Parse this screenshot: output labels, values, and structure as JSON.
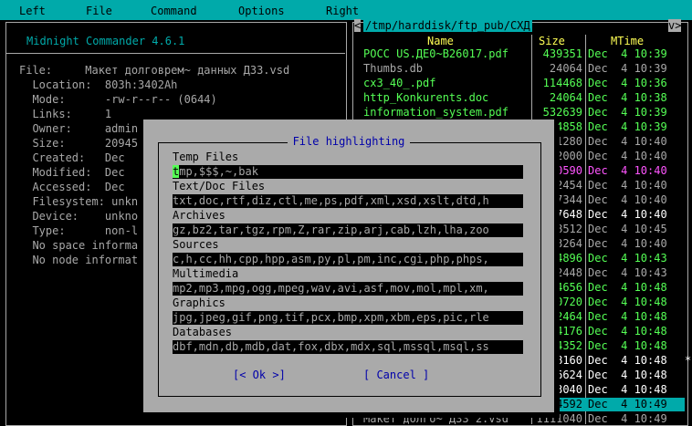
{
  "menu": [
    "Left",
    "File",
    "Command",
    "Options",
    "Right"
  ],
  "left_panel": {
    "title": "Midnight Commander 4.6.1",
    "info_lines": [
      "File:     Макет долговрем~ данных ДЗЗ.vsd",
      "  Location:  803h:3402Ah",
      "  Mode:      -rw-r--r-- (0644)",
      "  Links:     1",
      "  Owner:     admin",
      "  Size:      20945",
      "  Created:   Dec",
      "  Modified:  Dec",
      "  Accessed:  Dec",
      "  Filesystem: unkn",
      "  Device:    unkno",
      "  Type:      non-l",
      "  No space informa",
      "  No node informat"
    ]
  },
  "right_panel": {
    "path": "/tmp/harddisk/ftp_pub/СХД",
    "left_arrow": "<",
    "right_arrow": "v>",
    "col_name": "Name",
    "col_size": "Size",
    "col_mtime": "MTime",
    "files": [
      {
        "name": "РОСС US.ДЕ0~B26017.pdf",
        "size": "439351",
        "date": "Dec  4 10:39",
        "color": "green"
      },
      {
        "name": "Thumbs.db",
        "size": "24064",
        "date": "Dec  4 10:39",
        "color": "gray"
      },
      {
        "name": "cx3_40_.pdf",
        "size": "114468",
        "date": "Dec  4 10:36",
        "color": "green"
      },
      {
        "name": "http_Konkurents.doc",
        "size": "24064",
        "date": "Dec  4 10:38",
        "color": "green"
      },
      {
        "name": "information_system.pdf",
        "size": "532639",
        "date": "Dec  4 10:39",
        "color": "green"
      },
      {
        "name": "",
        "size": "4858",
        "date": "Dec  4 10:39",
        "color": "green"
      },
      {
        "name": "",
        "size": "1280",
        "date": "Dec  4 10:40",
        "color": "gray"
      },
      {
        "name": "",
        "size": "2000",
        "date": "Dec  4 10:40",
        "color": "gray"
      },
      {
        "name": "",
        "size": "0590",
        "date": "Dec  4 10:40",
        "color": "magenta"
      },
      {
        "name": "",
        "size": "2454",
        "date": "Dec  4 10:40",
        "color": "gray"
      },
      {
        "name": "",
        "size": "7344",
        "date": "Dec  4 10:40",
        "color": "gray"
      },
      {
        "name": "",
        "size": "7648",
        "date": "Dec  4 10:40",
        "color": "white"
      },
      {
        "name": "",
        "size": "8512",
        "date": "Dec  4 10:45",
        "color": "gray"
      },
      {
        "name": "",
        "size": "3264",
        "date": "Dec  4 10:40",
        "color": "gray"
      },
      {
        "name": "",
        "size": "4896",
        "date": "Dec  4 10:43",
        "color": "green"
      },
      {
        "name": "",
        "size": "2448",
        "date": "Dec  4 10:43",
        "color": "gray"
      },
      {
        "name": "",
        "size": "4656",
        "date": "Dec  4 10:48",
        "color": "green"
      },
      {
        "name": "",
        "size": "0720",
        "date": "Dec  4 10:48",
        "color": "green"
      },
      {
        "name": "",
        "size": "2464",
        "date": "Dec  4 10:48",
        "color": "green"
      },
      {
        "name": "",
        "size": "4176",
        "date": "Dec  4 10:48",
        "color": "green"
      },
      {
        "name": "",
        "size": "4352",
        "date": "Dec  4 10:48",
        "color": "green"
      },
      {
        "name": "",
        "size": "8160",
        "date": "Dec  4 10:48",
        "color": "white"
      },
      {
        "name": "",
        "size": "6624",
        "date": "Dec  4 10:48",
        "color": "white"
      },
      {
        "name": "",
        "size": "3040",
        "date": "Dec  4 10:48",
        "color": "white"
      },
      {
        "name": "",
        "size": "4592",
        "date": "Dec  4 10:49",
        "color": "selected"
      },
      {
        "name": "Макет долго~ ДЗЗ 2.vsd",
        "size": "1111040",
        "date": "Dec  4 10:49",
        "color": "gray"
      }
    ],
    "scroll_mark": "*"
  },
  "dialog": {
    "title": "File highlighting",
    "groups": [
      {
        "label": "Temp Files",
        "value": "tmp,$$$,~,bak"
      },
      {
        "label": "Text/Doc Files",
        "value": "txt,doc,rtf,diz,ctl,me,ps,pdf,xml,xsd,xslt,dtd,h"
      },
      {
        "label": "Archives",
        "value": "gz,bz2,tar,tgz,rpm,Z,rar,zip,arj,cab,lzh,lha,zoo"
      },
      {
        "label": "Sources",
        "value": "c,h,cc,hh,cpp,hpp,asm,py,pl,pm,inc,cgi,php,phps,"
      },
      {
        "label": "Multimedia",
        "value": "mp2,mp3,mpg,ogg,mpeg,wav,avi,asf,mov,mol,mpl,xm,"
      },
      {
        "label": "Graphics",
        "value": "jpg,jpeg,gif,png,tif,pcx,bmp,xpm,xbm,eps,pic,rle"
      },
      {
        "label": "Databases",
        "value": "dbf,mdn,db,mdb,dat,fox,dbx,mdx,sql,mssql,msql,ss"
      }
    ],
    "ok_label": "[< Ok >]",
    "cancel_label": "[ Cancel ]"
  }
}
